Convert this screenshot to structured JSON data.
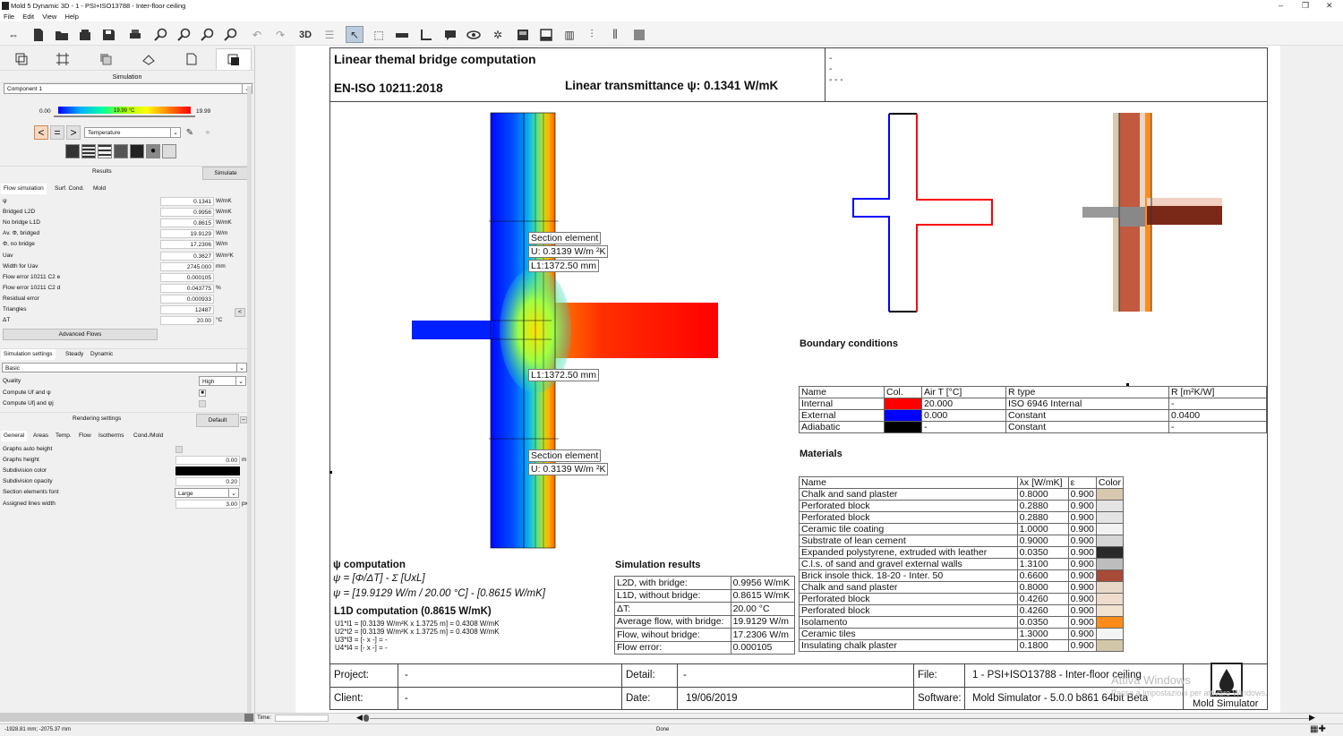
{
  "window": {
    "title": "Mold 5 Dynamic 3D - 1 - PSI+ISO13788 - Inter-floor ceiling",
    "controls": {
      "min": "–",
      "max": "❐",
      "close": "✕"
    }
  },
  "menu": [
    "File",
    "Edit",
    "View",
    "Help"
  ],
  "toolbar": {
    "3d_label": "3D"
  },
  "left": {
    "panel_title": "Simulation",
    "component": "Component 1",
    "scale": {
      "min": "0.00",
      "max": "19.99",
      "current": "19.99 °C"
    },
    "nav": {
      "prev": "<",
      "eq": "=",
      "next": ">"
    },
    "view_mode": "Temperature",
    "results_tab": "Results",
    "simulate_btn": "Simulate",
    "subtabs": [
      "Flow simulation",
      "Surf. Cond.",
      "Mold"
    ],
    "props": [
      {
        "label": "ψ",
        "value": "0.1341",
        "unit": "W/mK"
      },
      {
        "label": "Bridged L2D",
        "value": "0.9956",
        "unit": "W/mK"
      },
      {
        "label": "No bridge L1D",
        "value": "0.8615",
        "unit": "W/mK"
      },
      {
        "label": "Av. Φ, bridged",
        "value": "19.9129",
        "unit": "W/m"
      },
      {
        "label": "Φ, no bridge",
        "value": "17.2306",
        "unit": "W/m"
      },
      {
        "label": "Uav",
        "value": "0.3627",
        "unit": "W/m²K"
      },
      {
        "label": "Width for Uav",
        "value": "2745.000",
        "unit": "mm"
      },
      {
        "label": "Flow error 10211 C2 e",
        "value": "0.000105",
        "unit": ""
      },
      {
        "label": "Flow error 10211 C2 d",
        "value": "0.043775",
        "unit": "%"
      },
      {
        "label": "Residual error",
        "value": "0.000933",
        "unit": ""
      },
      {
        "label": "Triangles",
        "value": "12487",
        "unit": ""
      },
      {
        "label": "ΔT",
        "value": "20.00",
        "unit": "°C"
      }
    ],
    "width_btn": "<",
    "advanced_btn": "Advanced Flows",
    "sim_tabs": [
      "Simulation settings",
      "Steady",
      "Dynamic"
    ],
    "sim_mode": "Basic",
    "quality_label": "Quality",
    "quality_value": "High",
    "compute_uf": "Compute Uf and ψ",
    "compute_ufj": "Compute Ufj and ψj",
    "rendering_label": "Rendering settings",
    "default_btn": "Default",
    "render_tabs": [
      "General",
      "Areas",
      "Temp.",
      "Flow",
      "Isotherms",
      "Cond./Mold"
    ],
    "render_props": [
      {
        "label": "Graphs auto height",
        "value": ""
      },
      {
        "label": "Graphs height",
        "value": "0.00",
        "unit": "m"
      },
      {
        "label": "Subdivision color",
        "value": ""
      },
      {
        "label": "Subdivision opacity",
        "value": "0.20"
      },
      {
        "label": "Section elements font",
        "value": "Large"
      },
      {
        "label": "Assigned lines width",
        "value": "3.00",
        "unit": "px"
      }
    ]
  },
  "status": {
    "coords": "-1928.81 mm; -2075.37 mm",
    "time_label": "Time:",
    "done": "Done"
  },
  "report": {
    "title": "Linear themal bridge computation",
    "standard": "EN-ISO 10211:2018",
    "transmittance": "Linear transmittance ψ: 0.1341 W/mK",
    "notes": [
      "-",
      "-",
      "- - -"
    ],
    "section1": {
      "name": "Section element",
      "u": "U: 0.3139 W/m ²K",
      "l": "L1:1372.50 mm"
    },
    "section_mid": "L1:1372.50 mm",
    "section2": {
      "name": "Section element",
      "u": "U: 0.3139 W/m ²K"
    },
    "boundary_title": "Boundary conditions",
    "boundary_headers": [
      "Name",
      "Col.",
      "Air T [°C]",
      "R type",
      "R [m²K/W]"
    ],
    "boundary_rows": [
      {
        "name": "Internal",
        "color": "#ff0000",
        "t": "20.000",
        "rtype": "ISO 6946 Internal",
        "r": "-"
      },
      {
        "name": "External",
        "color": "#0000ff",
        "t": "0.000",
        "rtype": "Constant",
        "r": "0.0400"
      },
      {
        "name": "Adiabatic",
        "color": "#000000",
        "t": "-",
        "rtype": "Constant",
        "r": "-"
      }
    ],
    "materials_title": "Materials",
    "materials_headers": [
      "Name",
      "λx [W/mK]",
      "ε",
      "Color"
    ],
    "materials": [
      {
        "name": "Chalk and sand plaster",
        "l": "0.8000",
        "e": "0.900",
        "c": "#d8c8b0"
      },
      {
        "name": "Perforated block",
        "l": "0.2880",
        "e": "0.900",
        "c": "#e4e4e4"
      },
      {
        "name": "Perforated block",
        "l": "0.2880",
        "e": "0.900",
        "c": "#e4e4e4"
      },
      {
        "name": "Ceramic tile coating",
        "l": "1.0000",
        "e": "0.900",
        "c": "#f2f2f2"
      },
      {
        "name": "Substrate of lean cement",
        "l": "0.9000",
        "e": "0.900",
        "c": "#d6d6d6"
      },
      {
        "name": "Expanded polystyrene, extruded with leather",
        "l": "0.0350",
        "e": "0.900",
        "c": "#2a2a2a"
      },
      {
        "name": "C.l.s. of sand and gravel external walls",
        "l": "1.3100",
        "e": "0.900",
        "c": "#bdbdbd"
      },
      {
        "name": "Brick insole thick. 18-20 - Inter. 50",
        "l": "0.6600",
        "e": "0.900",
        "c": "#a84a38"
      },
      {
        "name": "Chalk and sand plaster",
        "l": "0.8000",
        "e": "0.900",
        "c": "#e8d8c8"
      },
      {
        "name": "Perforated block",
        "l": "0.4260",
        "e": "0.900",
        "c": "#f0dccc"
      },
      {
        "name": "Perforated block",
        "l": "0.4260",
        "e": "0.900",
        "c": "#f2e2d0"
      },
      {
        "name": "Isolamento",
        "l": "0.0350",
        "e": "0.900",
        "c": "#ff8c1a"
      },
      {
        "name": "Ceramic tiles",
        "l": "1.3000",
        "e": "0.900",
        "c": "#f4f4f4"
      },
      {
        "name": "Insulating chalk plaster",
        "l": "0.1800",
        "e": "0.900",
        "c": "#d2c6a8"
      }
    ],
    "psi": {
      "title": "ψ computation",
      "f1": "ψ = [Φ/ΔT] - Σ [UxL]",
      "f2": "ψ = [19.9129 W/m / 20.00 °C] - [0.8615 W/mK]",
      "l1d": "L1D computation  (0.8615 W/mK)",
      "lines": [
        "U1*l1 = [0.3139 W/m²K x 1.3725 m] = 0.4308 W/mK",
        "U2*l2 = [0.3139 W/m²K x 1.3725 m] = 0.4308 W/mK",
        "U3*l3 = [- x -] = -",
        "U4*l4 = [- x -] = -"
      ]
    },
    "sim_results": {
      "title": "Simulation results",
      "rows": [
        [
          "L2D, with bridge:",
          "0.9956 W/mK"
        ],
        [
          "L1D, without bridge:",
          "0.8615 W/mK"
        ],
        [
          "ΔT:",
          "20.00 °C"
        ],
        [
          "Average flow, with bridge:",
          "19.9129 W/m"
        ],
        [
          "Flow, wihout bridge:",
          "17.2306 W/m"
        ],
        [
          "Flow error:",
          "0.000105"
        ]
      ]
    },
    "footer": {
      "project_label": "Project:",
      "project": "-",
      "client_label": "Client:",
      "client": "-",
      "detail_label": "Detail:",
      "detail": "-",
      "date_label": "Date:",
      "date": "19/06/2019",
      "file_label": "File:",
      "file": "1 - PSI+ISO13788 - Inter-floor ceiling",
      "software_label": "Software:",
      "software": "Mold Simulator - 5.0.0 b861 64bit Beta",
      "brand": "Mold Simulator"
    },
    "watermark1": "Attiva Windows",
    "watermark2": "Passa a Impostazioni per attivare Windows."
  }
}
